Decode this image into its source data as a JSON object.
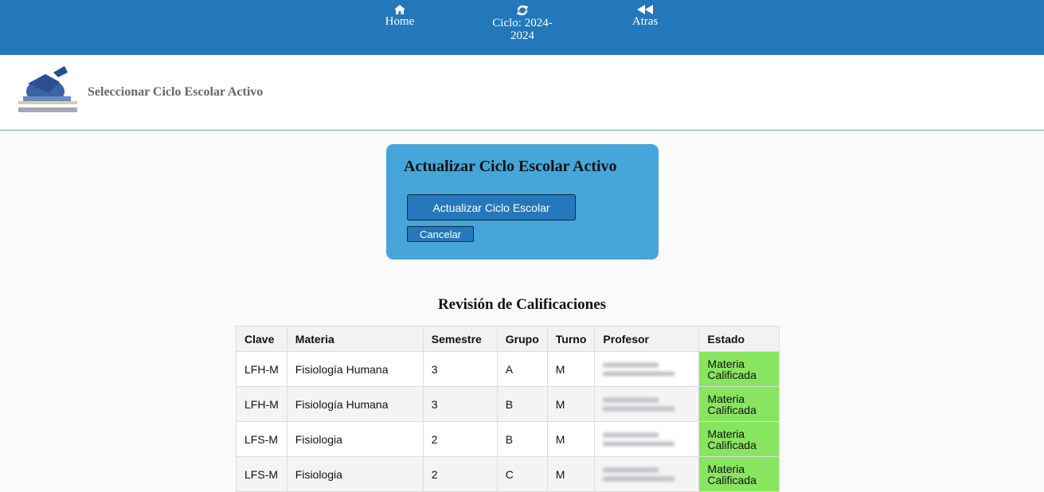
{
  "nav": {
    "home_label": "Home",
    "ciclo_label": "Ciclo: 2024-2024",
    "atras_label": "Atras"
  },
  "header": {
    "title": "Seleccionar Ciclo Escolar Activo"
  },
  "card": {
    "title": "Actualizar Ciclo Escolar Activo",
    "update_button": "Actualizar Ciclo Escolar",
    "cancel_button": "Cancelar"
  },
  "grades": {
    "title": "Revisión de Calificaciones",
    "headers": [
      "Clave",
      "Materia",
      "Semestre",
      "Grupo",
      "Turno",
      "Profesor",
      "Estado"
    ],
    "rows": [
      [
        "LFH-M",
        "Fisiología Humana",
        "3",
        "A",
        "M",
        "",
        "Materia Calificada"
      ],
      [
        "LFH-M",
        "Fisiología Humana",
        "3",
        "B",
        "M",
        "",
        "Materia Calificada"
      ],
      [
        "LFS-M",
        "Fisiologia",
        "2",
        "B",
        "M",
        "",
        "Materia Calificada"
      ],
      [
        "LFS-M",
        "Fisiologia",
        "2",
        "C",
        "M",
        "",
        "Materia Calificada"
      ]
    ]
  },
  "colors": {
    "topbar": "#2377bb",
    "card": "#46a6d9",
    "status_ok": "#88e55f"
  },
  "icons": {
    "home": "home-icon",
    "ciclo": "refresh-icon",
    "atras": "backward-icon"
  }
}
